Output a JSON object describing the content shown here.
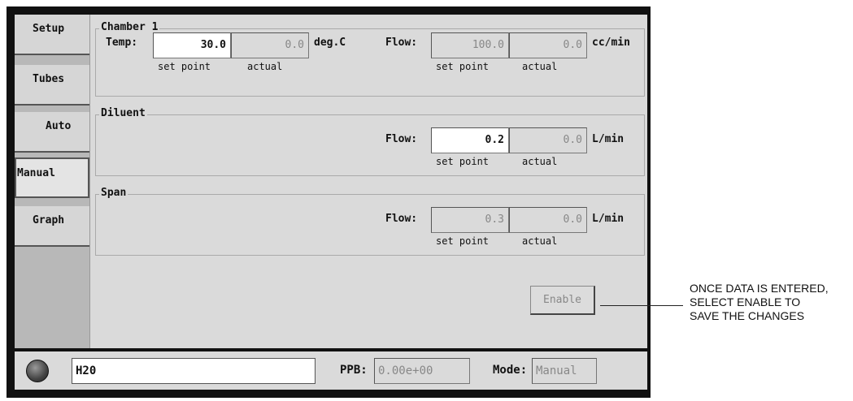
{
  "tabs": [
    {
      "label": "Setup"
    },
    {
      "label": "Tubes"
    },
    {
      "label": "Auto"
    },
    {
      "label": "Manual",
      "active": true
    },
    {
      "label": "Graph"
    }
  ],
  "chamber": {
    "title": "Chamber 1",
    "temp_label": "Temp:",
    "temp_setpoint": "30.0",
    "temp_actual": "0.0",
    "temp_unit": "deg.C",
    "flow_label": "Flow:",
    "flow_setpoint": "100.0",
    "flow_actual": "0.0",
    "flow_unit": "cc/min",
    "setpoint_caption": "set point",
    "actual_caption": "actual"
  },
  "diluent": {
    "title": "Diluent",
    "flow_label": "Flow:",
    "flow_setpoint": "0.2",
    "flow_actual": "0.0",
    "flow_unit": "L/min",
    "setpoint_caption": "set point",
    "actual_caption": "actual"
  },
  "span": {
    "title": "Span",
    "flow_label": "Flow:",
    "flow_setpoint": "0.3",
    "flow_actual": "0.0",
    "flow_unit": "L/min",
    "setpoint_caption": "set point",
    "actual_caption": "actual"
  },
  "enable_button": "Enable",
  "status": {
    "name_value": "H20",
    "ppb_label": "PPB:",
    "ppb_value": "0.00e+00",
    "mode_label": "Mode:",
    "mode_value": "Manual"
  },
  "annotation": "ONCE DATA IS ENTERED,\nSELECT ENABLE TO\nSAVE THE CHANGES"
}
